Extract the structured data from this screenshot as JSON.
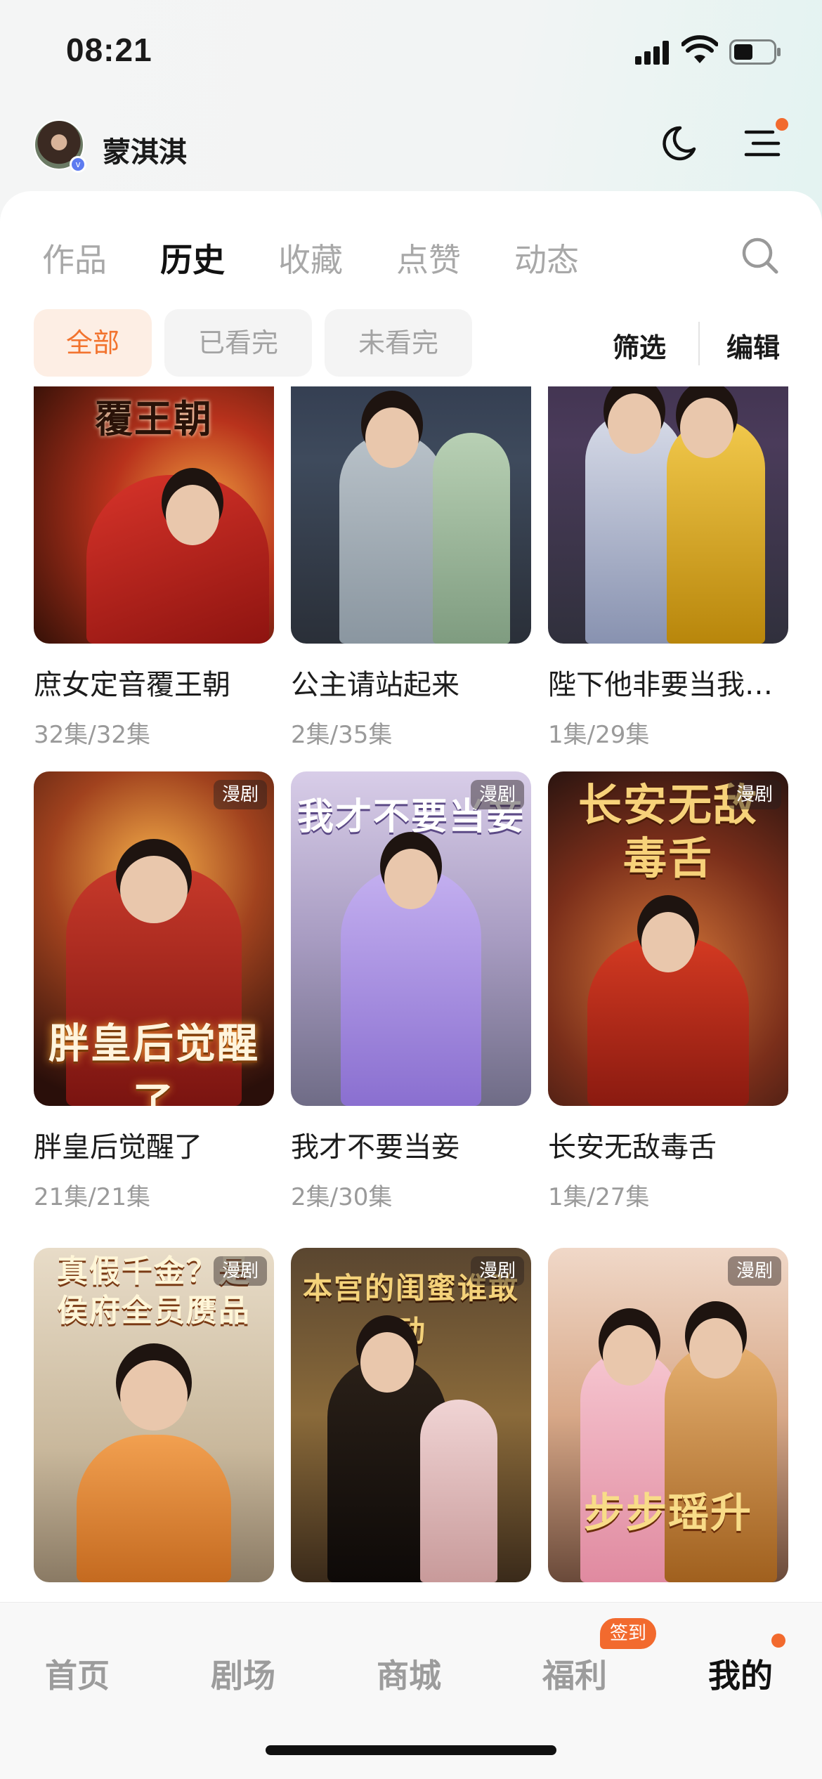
{
  "status_bar": {
    "time": "08:21"
  },
  "header": {
    "username": "蒙淇淇",
    "verified_mark": "v"
  },
  "tabs": [
    {
      "label": "作品",
      "active": false
    },
    {
      "label": "历史",
      "active": true
    },
    {
      "label": "收藏",
      "active": false
    },
    {
      "label": "点赞",
      "active": false
    },
    {
      "label": "动态",
      "active": false
    }
  ],
  "filters": {
    "chips": [
      {
        "label": "全部",
        "active": true
      },
      {
        "label": "已看完",
        "active": false
      },
      {
        "label": "未看完",
        "active": false
      }
    ],
    "filter_label": "筛选",
    "edit_label": "编辑"
  },
  "cards": [
    {
      "title": "庶女定音覆王朝",
      "episodes": "32集/32集",
      "cover_text": "覆王朝",
      "badge": ""
    },
    {
      "title": "公主请站起来",
      "episodes": "2集/35集",
      "cover_text": "",
      "badge": ""
    },
    {
      "title": "陛下他非要当我…",
      "episodes": "1集/29集",
      "cover_text": "",
      "badge": ""
    },
    {
      "title": "胖皇后觉醒了",
      "episodes": "21集/21集",
      "cover_text": "胖皇后觉醒了",
      "badge": "漫剧"
    },
    {
      "title": "我才不要当妾",
      "episodes": "2集/30集",
      "cover_text": "我才不要当妾",
      "badge": "漫剧"
    },
    {
      "title": "长安无敌毒舌",
      "episodes": "1集/27集",
      "cover_text": "长安无敌毒舌",
      "badge": "漫剧"
    },
    {
      "title": "",
      "episodes": "",
      "cover_text": "真假千金？是侯府全员赝品",
      "badge": "漫剧"
    },
    {
      "title": "",
      "episodes": "",
      "cover_text": "本宫的闺蜜谁敢动",
      "badge": "漫剧"
    },
    {
      "title": "",
      "episodes": "",
      "cover_text": "步步瑶升",
      "badge": "漫剧"
    }
  ],
  "bottom_nav": {
    "items": [
      {
        "label": "首页",
        "active": false
      },
      {
        "label": "剧场",
        "active": false
      },
      {
        "label": "商城",
        "active": false
      },
      {
        "label": "福利",
        "active": false
      },
      {
        "label": "我的",
        "active": true
      }
    ],
    "checkin_badge": "签到"
  },
  "colors": {
    "accent": "#f26a2e",
    "chip_active_bg": "#fdeee4",
    "text_primary": "#1a1a1a",
    "text_secondary": "#9a9a9a"
  }
}
